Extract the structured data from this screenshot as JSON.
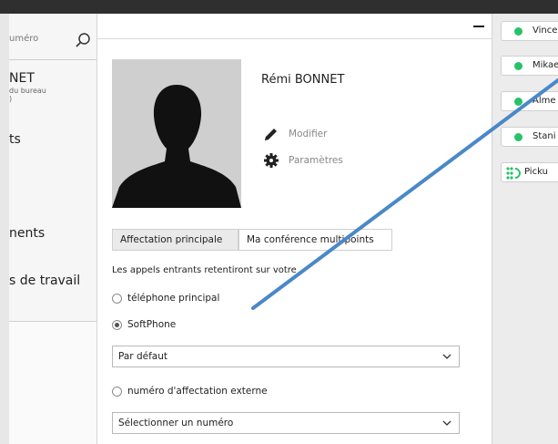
{
  "sidebar": {
    "search_placeholder": "uméro",
    "user_name": "NET",
    "user_subtitle_line1": "du bureau",
    "user_subtitle_line2": ")",
    "items": [
      {
        "label": "ts"
      },
      {
        "label": "nents"
      },
      {
        "label": "s de travail"
      }
    ]
  },
  "profile": {
    "name": "Rémi BONNET",
    "modify_label": "Modifier",
    "settings_label": "Paramètres"
  },
  "tabs": [
    {
      "label": "Affectation principale",
      "active": true
    },
    {
      "label": "Ma conférence multipoints",
      "active": false
    }
  ],
  "routing": {
    "info_text": "Les appels entrants retentiront sur votre",
    "options": [
      {
        "label": "téléphone principal",
        "checked": false
      },
      {
        "label": "SoftPhone",
        "checked": true
      },
      {
        "label": "numéro d'affectation externe",
        "checked": false
      }
    ],
    "softphone_select_value": "Par défaut",
    "external_select_value": "Sélectionner un numéro"
  },
  "contacts": [
    {
      "name": "Vince",
      "status_color": "#27c26a"
    },
    {
      "name": "Mikae",
      "status_color": "#27c26a"
    },
    {
      "name": "Alme",
      "status_color": "#27c26a"
    },
    {
      "name": "Stani",
      "status_color": "#27c26a"
    }
  ],
  "pickup": {
    "label": "Picku"
  },
  "colors": {
    "accent_status": "#27c26a",
    "annotation_line": "#4a88c7",
    "topbar": "#2f2f2f"
  }
}
